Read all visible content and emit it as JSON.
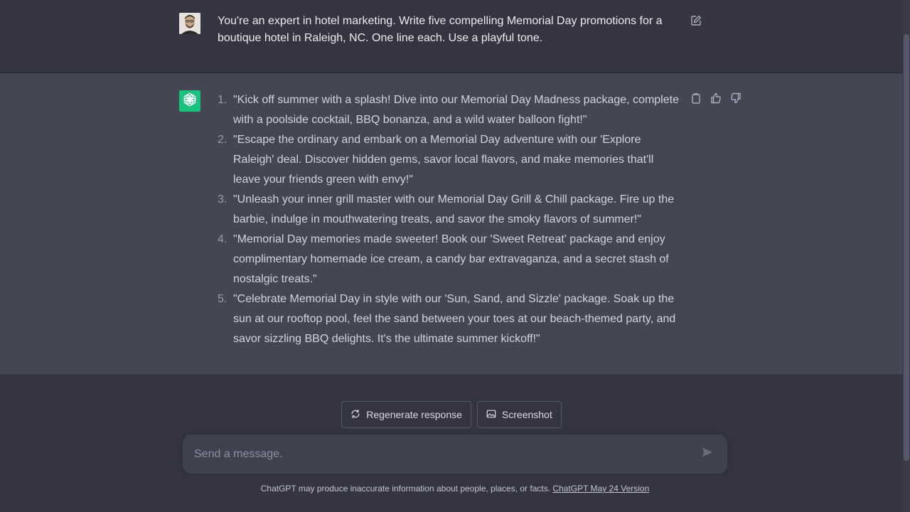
{
  "conversation": {
    "user_message": "You're an expert in hotel marketing. Write five compelling Memorial Day promotions for a boutique hotel in Raleigh, NC. One line each. Use a playful tone.",
    "assistant_items": [
      {
        "num": "1.",
        "text": "\"Kick off summer with a splash! Dive into our Memorial Day Madness package, complete with a poolside cocktail, BBQ bonanza, and a wild water balloon fight!\""
      },
      {
        "num": "2.",
        "text": "\"Escape the ordinary and embark on a Memorial Day adventure with our 'Explore Raleigh' deal. Discover hidden gems, savor local flavors, and make memories that'll leave your friends green with envy!\""
      },
      {
        "num": "3.",
        "text": "\"Unleash your inner grill master with our Memorial Day Grill & Chill package. Fire up the barbie, indulge in mouthwatering treats, and savor the smoky flavors of summer!\""
      },
      {
        "num": "4.",
        "text": "\"Memorial Day memories made sweeter! Book our 'Sweet Retreat' package and enjoy complimentary homemade ice cream, a candy bar extravaganza, and a secret stash of nostalgic treats.\""
      },
      {
        "num": "5.",
        "text": "\"Celebrate Memorial Day in style with our 'Sun, Sand, and Sizzle' package. Soak up the sun at our rooftop pool, feel the sand between your toes at our beach-themed party, and savor sizzling BBQ delights. It's the ultimate summer kickoff!\""
      }
    ]
  },
  "actions": {
    "regenerate_label": "Regenerate response",
    "screenshot_label": "Screenshot"
  },
  "composer": {
    "placeholder": "Send a message."
  },
  "footer": {
    "disclaimer": "ChatGPT may produce inaccurate information about people, places, or facts.",
    "version_link": "ChatGPT May 24 Version"
  },
  "colors": {
    "background": "#343541",
    "assistant_background": "#444654",
    "brand_green": "#19c37d"
  },
  "icons": [
    "sidebar-toggle-icon",
    "edit-icon",
    "copy-icon",
    "thumbs-up-icon",
    "thumbs-down-icon",
    "refresh-icon",
    "screenshot-icon",
    "send-icon",
    "openai-logo-icon"
  ]
}
